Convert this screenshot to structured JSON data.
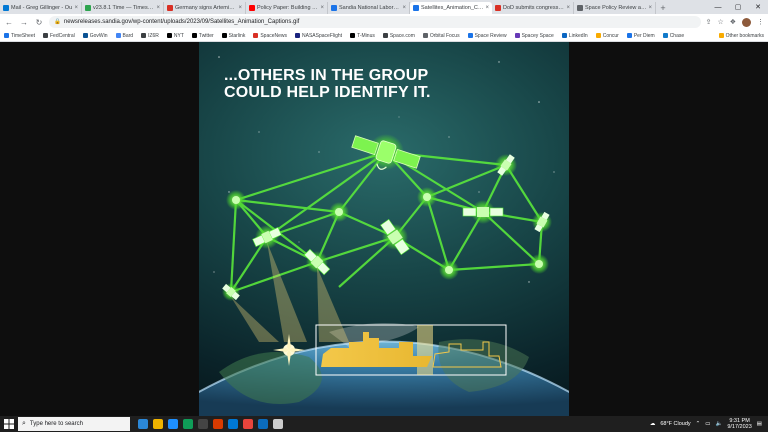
{
  "browser": {
    "tabs": [
      {
        "title": "Mail - Greg Gillinger - Ou",
        "color": "#0078d4",
        "active": false
      },
      {
        "title": "v23.8.1 Time — Timeshee",
        "color": "#2da44e",
        "active": false
      },
      {
        "title": "Germany signs Artemis Ac",
        "color": "#d93025",
        "active": false
      },
      {
        "title": "Policy Paper: Building U.S.",
        "color": "#ff0000",
        "active": false
      },
      {
        "title": "Sandia National Laborator",
        "color": "#1a73e8",
        "active": false
      },
      {
        "title": "Satellites_Animation_Capti",
        "color": "#1a73e8",
        "active": true
      },
      {
        "title": "DoD submits congression",
        "color": "#d93025",
        "active": false
      },
      {
        "title": "Space Policy Review and S",
        "color": "#5f6368",
        "active": false
      }
    ],
    "tab_close": "×",
    "new_tab": "+",
    "window_controls": {
      "minimize": "—",
      "maximize": "▢",
      "close": "✕"
    },
    "url": "newsreleases.sandia.gov/wp-content/uploads/2023/09/Satellites_Animation_Captions.gif",
    "nav": {
      "back": "←",
      "forward": "→",
      "reload": "↻"
    },
    "toolbar_icons": {
      "share": "⇪",
      "star": "☆",
      "extensions": "❖",
      "menu": "⋮"
    },
    "bookmarks": [
      {
        "label": "TimeSheet",
        "color": "#1a73e8"
      },
      {
        "label": "FedCentral",
        "color": "#3c4043"
      },
      {
        "label": "GovWin",
        "color": "#0b5394"
      },
      {
        "label": "Bard",
        "color": "#4285f4"
      },
      {
        "label": "IZ6R",
        "color": "#3c4043"
      },
      {
        "label": "NYT",
        "color": "#000000"
      },
      {
        "label": "Twitter",
        "color": "#000000"
      },
      {
        "label": "Starlink",
        "color": "#000000"
      },
      {
        "label": "SpaceNews",
        "color": "#d93025"
      },
      {
        "label": "NASASpaceFlight",
        "color": "#1a237e"
      },
      {
        "label": "T-Minus",
        "color": "#000000"
      },
      {
        "label": "Space.com",
        "color": "#3c4043"
      },
      {
        "label": "Orbital Focus",
        "color": "#5f6368"
      },
      {
        "label": "Space Review",
        "color": "#1a73e8"
      },
      {
        "label": "Spacey Space",
        "color": "#673ab7"
      },
      {
        "label": "LinkedIn",
        "color": "#0a66c2"
      },
      {
        "label": "Concur",
        "color": "#f9ab00"
      },
      {
        "label": "Per Diem",
        "color": "#1a73e8"
      },
      {
        "label": "Chase",
        "color": "#117aca"
      }
    ],
    "other_bookmarks": "Other bookmarks"
  },
  "gif": {
    "headline_line1": "...OTHERS IN THE GROUP",
    "headline_line2": "COULD HELP IDENTIFY IT."
  },
  "taskbar": {
    "search_placeholder": "Type here to search",
    "weather": "68°F  Cloudy",
    "time": "9:31 PM",
    "date": "9/17/2023",
    "apps": [
      "#2b88d8",
      "#f0b400",
      "#1e90ff",
      "#0f9d58",
      "#444444",
      "#d83b01",
      "#0078d4",
      "#e8453c",
      "#0b6cbd",
      "#cccccc"
    ]
  }
}
